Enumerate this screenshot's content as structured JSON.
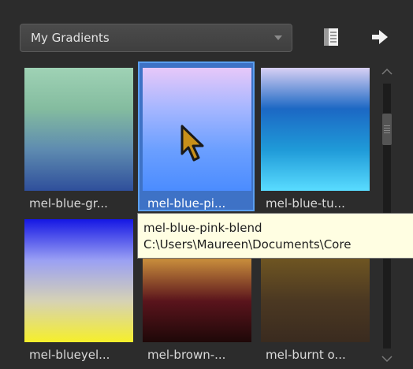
{
  "dropdown": {
    "selected": "My Gradients"
  },
  "toolbar": {
    "save_icon": "save-icon",
    "next_icon": "arrow-right-icon"
  },
  "gradients": [
    {
      "label": "mel-blue-gr...",
      "colors": [
        "#9fd2b5",
        "#84bc9f",
        "#5e8bb0",
        "#2f4f9b"
      ]
    },
    {
      "label": "mel-blue-pi...",
      "colors": [
        "#e7c8f9",
        "#a5b6ff",
        "#6b9fff",
        "#4b8cff"
      ]
    },
    {
      "label": "mel-blue-tu...",
      "colors": [
        "#d8d0f4",
        "#1c68c4",
        "#1f9ad8",
        "#59dcff"
      ]
    },
    {
      "label": "mel-blueyel...",
      "colors": [
        "#1517e4",
        "#9aa0f4",
        "#d6d2b4",
        "#f6ef2a"
      ]
    },
    {
      "label": "mel-brown-...",
      "colors": [
        "#3a0e10",
        "#c58a3b",
        "#5a141c",
        "#1e0808"
      ]
    },
    {
      "label": "mel-burnt o...",
      "colors": [
        "#d7ad3a",
        "#6d5422",
        "#4b3822",
        "#3a2b1f"
      ]
    }
  ],
  "tooltip": {
    "title": "mel-blue-pink-blend",
    "path": "C:\\Users\\Maureen\\Documents\\Core"
  },
  "colors": {
    "background": "#2c2c2c",
    "selection": "#3e72c6",
    "tooltip_bg": "#fffee2"
  }
}
